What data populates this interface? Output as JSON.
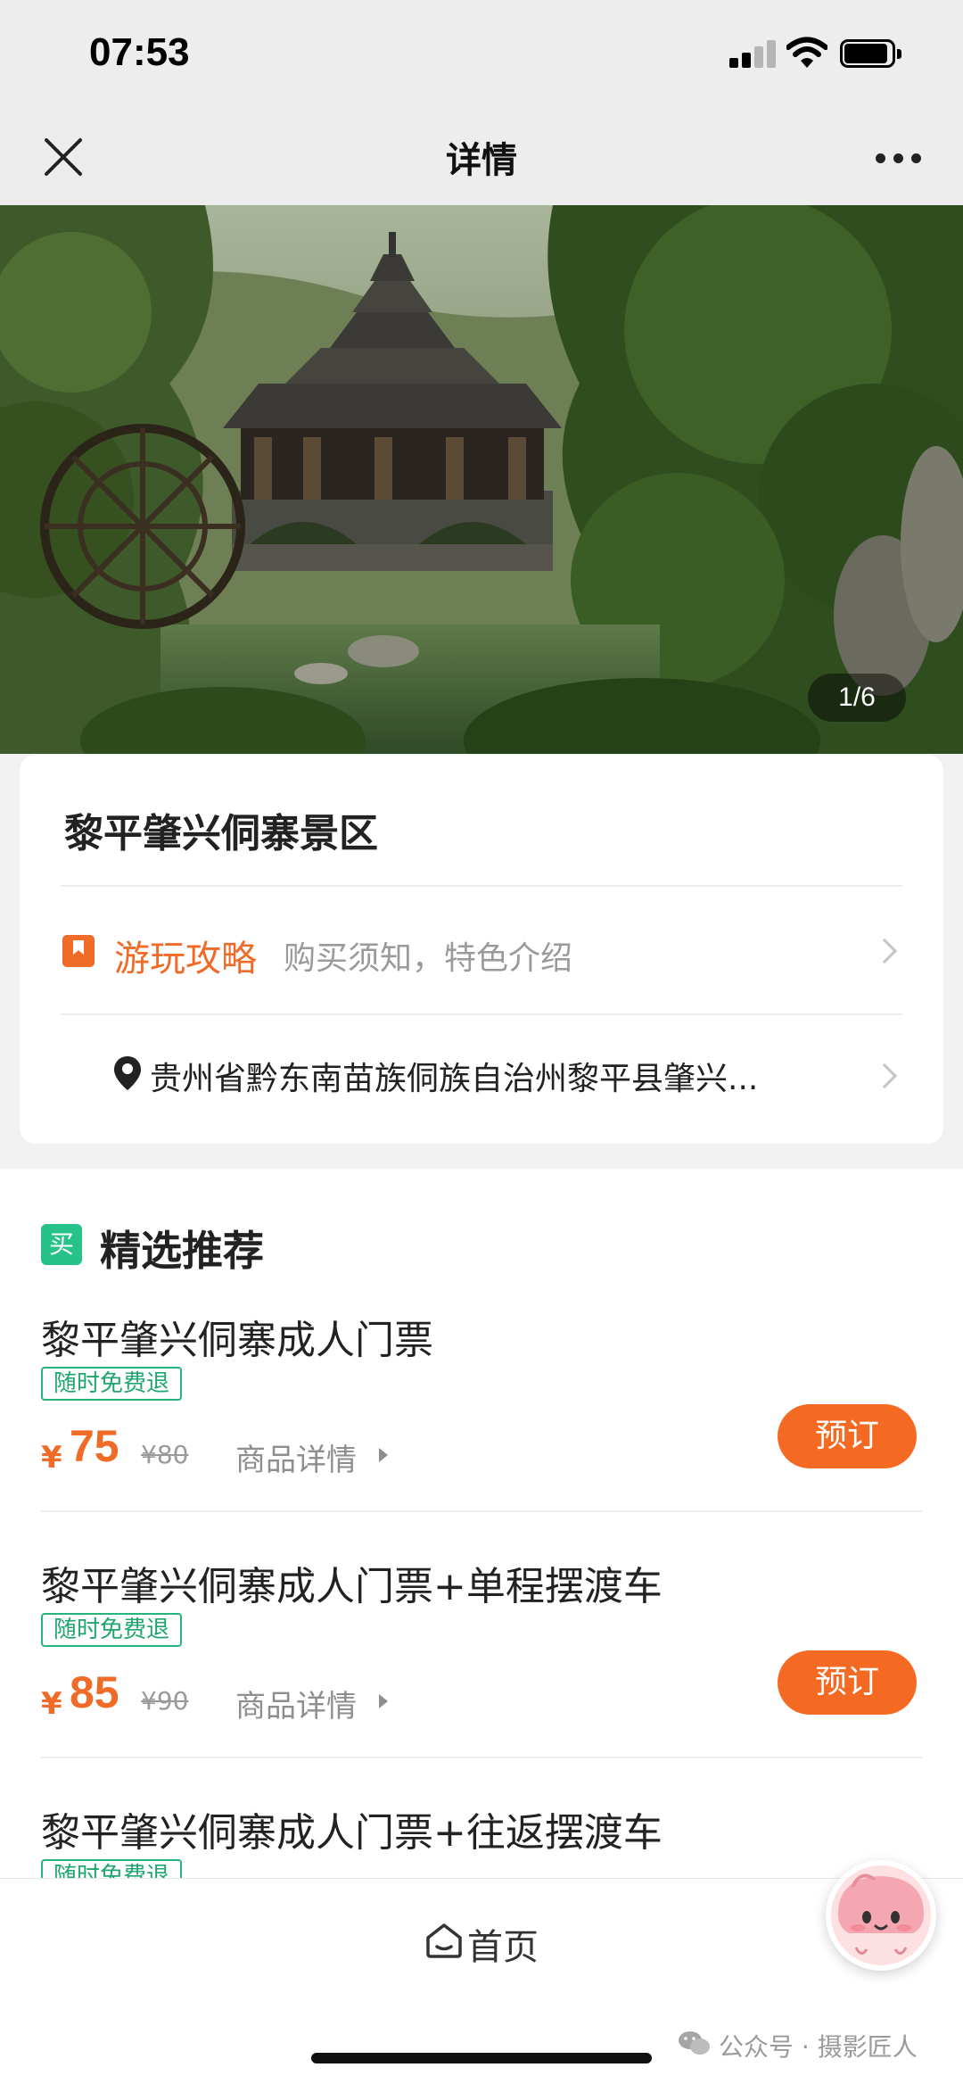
{
  "status_bar": {
    "time": "07:53",
    "signal_icon": "cellular-signal-icon",
    "wifi_icon": "wifi-icon",
    "battery_icon": "battery-icon"
  },
  "nav": {
    "title": "详情",
    "close_icon": "close-icon",
    "more_icon": "more-icon"
  },
  "hero": {
    "counter": "1/6"
  },
  "scenic": {
    "title": "黎平肇兴侗寨景区",
    "guide_label": "游玩攻略",
    "guide_sub": "购买须知，特色介绍",
    "address": "贵州省黔东南苗族侗族自治州黎平县肇兴..."
  },
  "recommend": {
    "badge": "买",
    "title": "精选推荐",
    "products": [
      {
        "name": "黎平肇兴侗寨成人门票",
        "tag": "随时免费退",
        "currency": "¥",
        "price": "75",
        "original_price": "¥80",
        "detail_label": "商品详情",
        "book_label": "预订"
      },
      {
        "name": "黎平肇兴侗寨成人门票+单程摆渡车",
        "tag": "随时免费退",
        "currency": "¥",
        "price": "85",
        "original_price": "¥90",
        "detail_label": "商品详情",
        "book_label": "预订"
      },
      {
        "name": "黎平肇兴侗寨成人门票+往返摆渡车",
        "tag": "随时免费退"
      }
    ]
  },
  "bottom_bar": {
    "home_label": "首页",
    "watermark": "公众号 · 摄影匠人"
  },
  "colors": {
    "accent_orange": "#f06a28",
    "book_button": "#f56a23",
    "green_tag": "#27b37c",
    "nav_background": "#ededed"
  }
}
